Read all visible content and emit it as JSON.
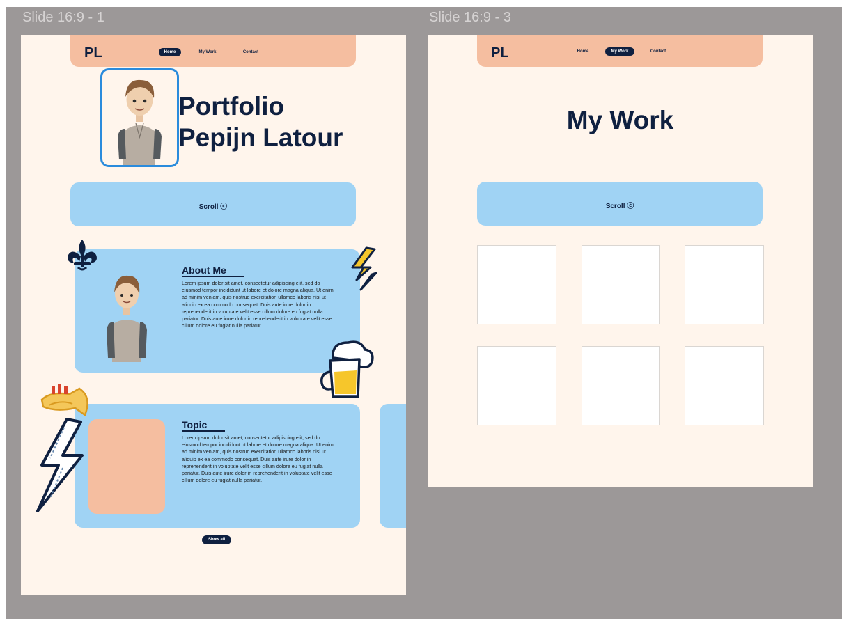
{
  "slides": [
    {
      "frame_label": "Slide 16:9 - 1",
      "nav": {
        "logo": "PL",
        "links": [
          "Home",
          "My Work",
          "Contact"
        ],
        "active": 0
      },
      "hero": {
        "line1": "Portfolio",
        "line2": "Pepijn Latour"
      },
      "scroll_label": "Scroll",
      "about": {
        "title": "About Me",
        "body": "Lorem ipsum dolor sit amet, consectetur adipiscing elit, sed do eiusmod tempor incididunt ut labore et dolore magna aliqua. Ut enim ad minim veniam, quis nostrud exercitation ullamco laboris nisi ut aliquip ex ea commodo consequat. Duis aute irure dolor in reprehenderit in voluptate velit esse cillum dolore eu fugiat nulla pariatur. Duis aute irure dolor in reprehenderit in voluptate velit esse cillum dolore eu fugiat nulla pariatur."
      },
      "topic": {
        "title": "Topic",
        "body": "Lorem ipsum dolor sit amet, consectetur adipiscing elit, sed do eiusmod tempor incididunt ut labore et dolore magna aliqua. Ut enim ad minim veniam, quis nostrud exercitation ullamco laboris nisi ut aliquip ex ea commodo consequat. Duis aute irure dolor in reprehenderit in voluptate velit esse cillum dolore eu fugiat nulla pariatur. Duis aute irure dolor in reprehenderit in voluptate velit esse cillum dolore eu fugiat nulla pariatur."
      },
      "show_all": "Show all"
    },
    {
      "frame_label": "Slide 16:9 - 3",
      "nav": {
        "logo": "PL",
        "links": [
          "Home",
          "My Work",
          "Contact"
        ],
        "active": 1
      },
      "title": "My Work",
      "scroll_label": "Scroll"
    }
  ],
  "colors": {
    "canvas": "#9c9898",
    "slide_bg": "#fff5ec",
    "nav_bg": "#f5bea0",
    "accent_blue": "#a0d3f4",
    "navy": "#0f2040",
    "frame_border": "#2a8bdc"
  }
}
